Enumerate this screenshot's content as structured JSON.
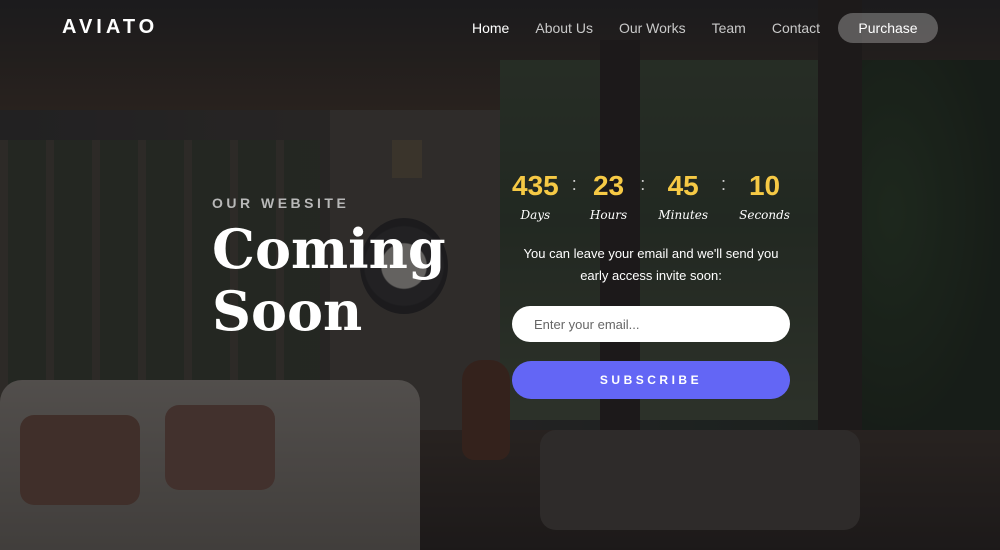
{
  "brand": {
    "logo": "AVIATO"
  },
  "nav": {
    "items": [
      {
        "label": "Home",
        "active": true
      },
      {
        "label": "About Us",
        "active": false
      },
      {
        "label": "Our Works",
        "active": false
      },
      {
        "label": "Team",
        "active": false
      },
      {
        "label": "Contact",
        "active": false
      }
    ],
    "purchase_label": "Purchase"
  },
  "hero": {
    "eyebrow": "OUR WEBSITE",
    "title_line1": "Coming",
    "title_line2": "Soon"
  },
  "countdown": [
    {
      "value": "435",
      "label": "Days"
    },
    {
      "value": "23",
      "label": "Hours"
    },
    {
      "value": "45",
      "label": "Minutes"
    },
    {
      "value": "10",
      "label": "Seconds"
    }
  ],
  "signup": {
    "note": "You can leave your email and we'll send you early access invite soon:",
    "email_placeholder": "Enter your email...",
    "subscribe_label": "SUBSCRIBE"
  },
  "colors": {
    "accent_button": "#6366f5",
    "countdown_number": "#f6c945"
  }
}
